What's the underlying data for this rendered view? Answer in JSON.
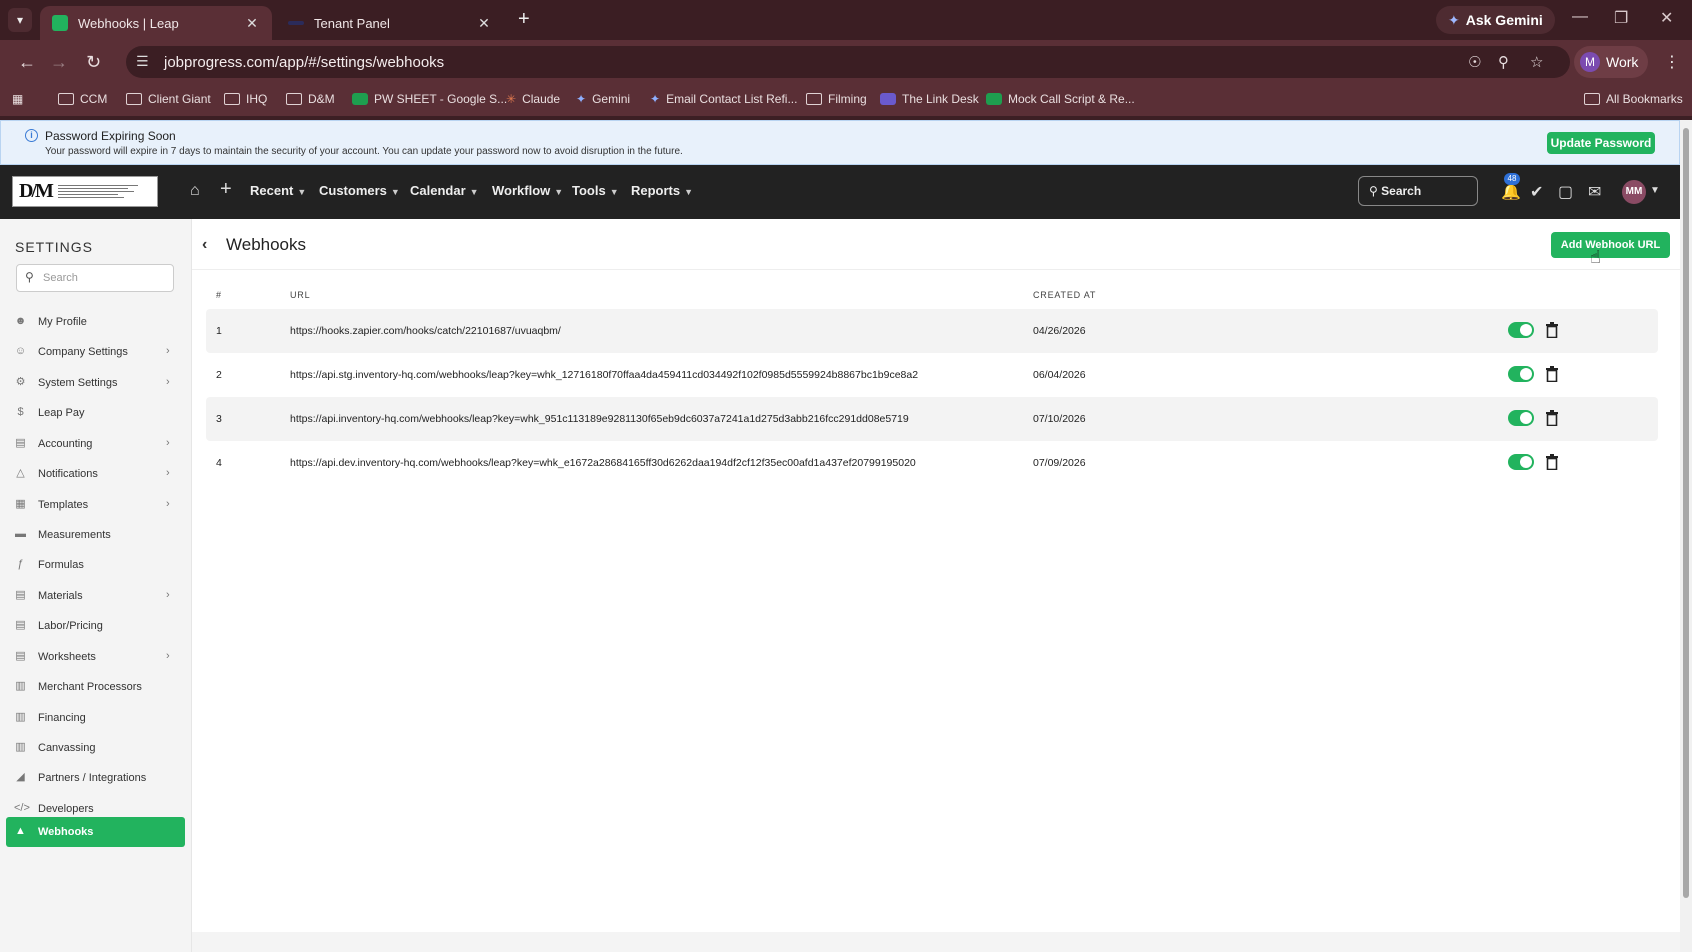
{
  "browser": {
    "tabs": [
      {
        "title": "Webhooks | Leap",
        "active": true
      },
      {
        "title": "Tenant Panel",
        "active": false
      }
    ],
    "ask_gemini": "Ask Gemini",
    "url": "jobprogress.com/app/#/settings/webhooks",
    "profile": {
      "initial": "M",
      "label": "Work"
    },
    "bookmarks": [
      "CCM",
      "Client Giant",
      "IHQ",
      "D&M",
      "PW SHEET - Google S...",
      "Claude",
      "Gemini",
      "Email Contact List Refi...",
      "Filming",
      "The Link Desk",
      "Mock Call Script & Re..."
    ],
    "all_bookmarks": "All Bookmarks"
  },
  "alert": {
    "title": "Password Expiring Soon",
    "message": "Your password will expire in 7 days to maintain the security of your account. You can update your password now to avoid disruption in the future.",
    "button": "Update Password"
  },
  "nav": {
    "items": [
      "Recent",
      "Customers",
      "Calendar",
      "Workflow",
      "Tools",
      "Reports"
    ],
    "search_label": "Search",
    "notification_count": "48",
    "user_initials": "MM"
  },
  "sidebar": {
    "title": "SETTINGS",
    "search_placeholder": "Search",
    "items": [
      {
        "label": "My Profile",
        "has_children": false
      },
      {
        "label": "Company Settings",
        "has_children": true
      },
      {
        "label": "System Settings",
        "has_children": true
      },
      {
        "label": "Leap Pay",
        "has_children": false
      },
      {
        "label": "Accounting",
        "has_children": true
      },
      {
        "label": "Notifications",
        "has_children": true
      },
      {
        "label": "Templates",
        "has_children": true
      },
      {
        "label": "Measurements",
        "has_children": false
      },
      {
        "label": "Formulas",
        "has_children": false
      },
      {
        "label": "Materials",
        "has_children": true
      },
      {
        "label": "Labor/Pricing",
        "has_children": false
      },
      {
        "label": "Worksheets",
        "has_children": true
      },
      {
        "label": "Merchant Processors",
        "has_children": false
      },
      {
        "label": "Financing",
        "has_children": false
      },
      {
        "label": "Canvassing",
        "has_children": false
      },
      {
        "label": "Partners / Integrations",
        "has_children": false
      },
      {
        "label": "Developers",
        "has_children": false
      },
      {
        "label": "Webhooks",
        "has_children": false,
        "active": true
      }
    ]
  },
  "main": {
    "title": "Webhooks",
    "add_button": "Add Webhook URL",
    "columns": {
      "num": "#",
      "url": "URL",
      "created": "CREATED AT"
    },
    "rows": [
      {
        "num": "1",
        "url": "https://hooks.zapier.com/hooks/catch/22101687/uvuaqbm/",
        "created": "04/26/2026",
        "enabled": true
      },
      {
        "num": "2",
        "url": "https://api.stg.inventory-hq.com/webhooks/leap?key=whk_12716180f70ffaa4da459411cd034492f102f0985d5559924b8867bc1b9ce8a2",
        "created": "06/04/2026",
        "enabled": true
      },
      {
        "num": "3",
        "url": "https://api.inventory-hq.com/webhooks/leap?key=whk_951c113189e9281130f65eb9dc6037a7241a1d275d3abb216fcc291dd08e5719",
        "created": "07/10/2026",
        "enabled": true
      },
      {
        "num": "4",
        "url": "https://api.dev.inventory-hq.com/webhooks/leap?key=whk_e1672a28684165ff30d6262daa194df2cf12f35ec00afd1a437ef20799195020",
        "created": "07/09/2026",
        "enabled": true
      }
    ]
  },
  "colors": {
    "accent_green": "#22b35e",
    "nav_dark": "#222222",
    "browser_frame": "#5a2f36"
  }
}
